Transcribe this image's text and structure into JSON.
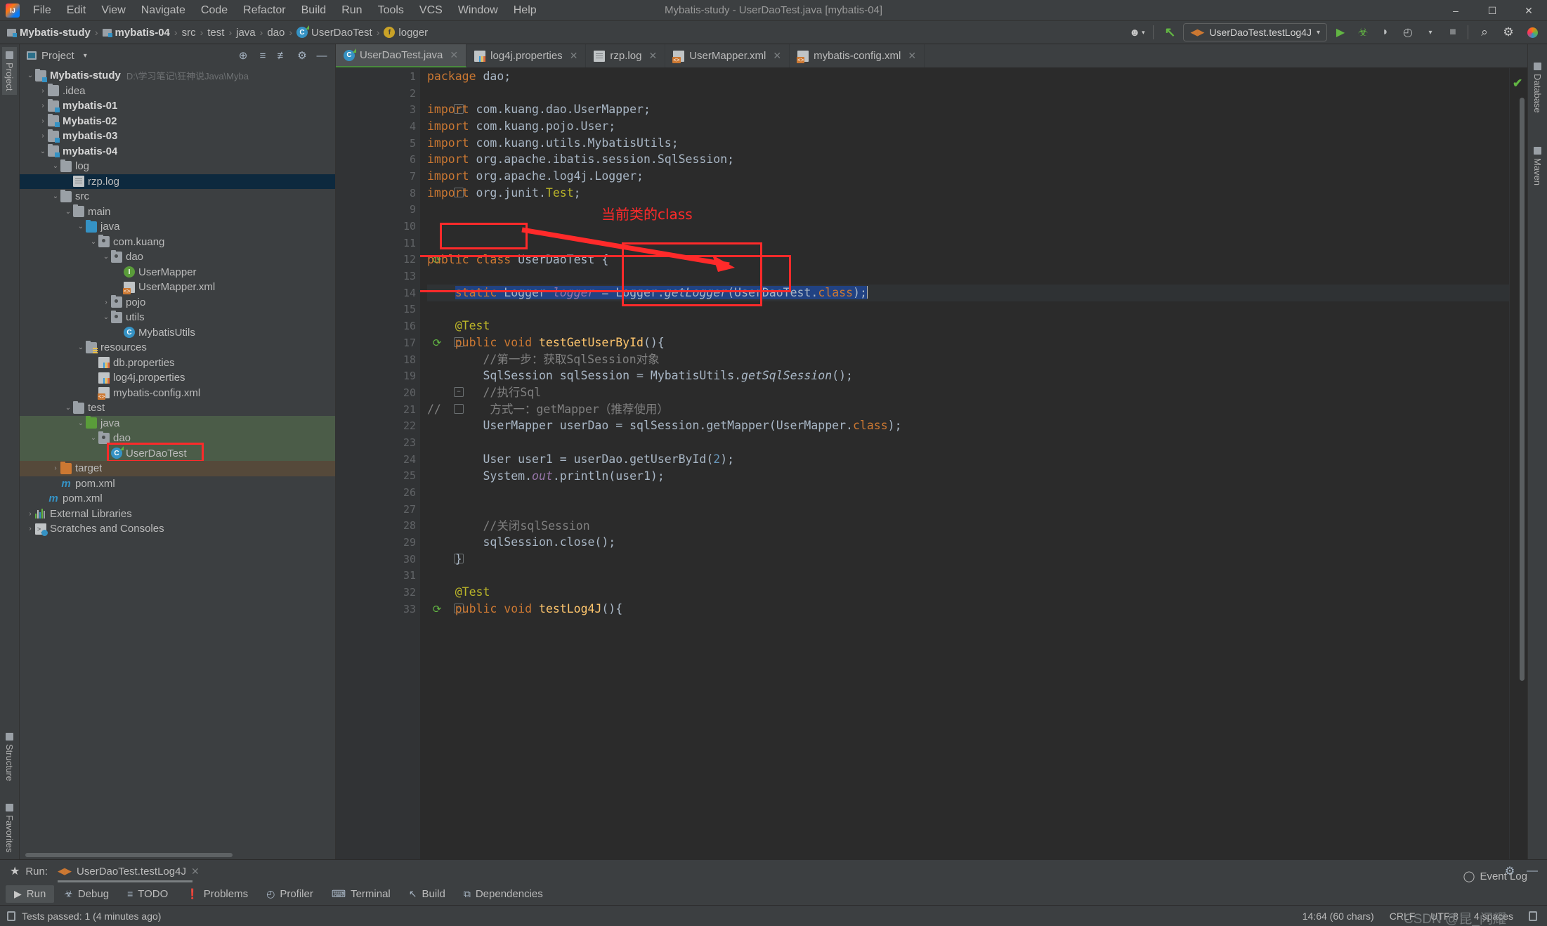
{
  "window": {
    "title": "Mybatis-study - UserDaoTest.java [mybatis-04]",
    "minimize": "–",
    "maximize": "☐",
    "close": "✕"
  },
  "menu": [
    {
      "label": "File"
    },
    {
      "label": "Edit"
    },
    {
      "label": "View"
    },
    {
      "label": "Navigate"
    },
    {
      "label": "Code"
    },
    {
      "label": "Refactor"
    },
    {
      "label": "Build"
    },
    {
      "label": "Run"
    },
    {
      "label": "Tools"
    },
    {
      "label": "VCS"
    },
    {
      "label": "Window"
    },
    {
      "label": "Help"
    }
  ],
  "breadcrumb": {
    "sep": "›",
    "items": [
      {
        "label": "Mybatis-study",
        "icon": "module-icon",
        "bold": true
      },
      {
        "label": "mybatis-04",
        "icon": "module-icon",
        "bold": true
      },
      {
        "label": "src",
        "icon": "none"
      },
      {
        "label": "test",
        "icon": "none"
      },
      {
        "label": "java",
        "icon": "none"
      },
      {
        "label": "dao",
        "icon": "none"
      },
      {
        "label": "UserDaoTest",
        "icon": "class-icon"
      },
      {
        "label": "logger",
        "icon": "field-icon"
      }
    ]
  },
  "toolbar": {
    "run_config": "UserDaoTest.testLog4J",
    "run_config_dropdown": "▾",
    "buttons": [
      {
        "name": "run-button",
        "glyph": "▶"
      },
      {
        "name": "debug-button",
        "glyph": "☣"
      },
      {
        "name": "run-with-coverage-button",
        "glyph": "◗"
      },
      {
        "name": "profiler-button",
        "glyph": "◴"
      },
      {
        "name": "profiler-dropdown",
        "glyph": "▾"
      },
      {
        "name": "stop-button",
        "glyph": "■"
      },
      {
        "name": "search-everywhere-button",
        "glyph": "⚲"
      },
      {
        "name": "settings-button",
        "glyph": "⚙"
      }
    ],
    "user_icon": "☻",
    "user_dropdown": "▾",
    "build_icon": "↖"
  },
  "left_rail": [
    {
      "label": "Project",
      "active": true
    },
    {
      "label": "Structure",
      "active": false
    },
    {
      "label": "Favorites",
      "active": false
    }
  ],
  "right_rail": [
    {
      "label": "Database"
    },
    {
      "label": "Maven"
    }
  ],
  "project_panel": {
    "title": "Project",
    "title_dropdown": "▾",
    "actions": [
      {
        "name": "select-opened-file-button",
        "glyph": "⊕"
      },
      {
        "name": "expand-all-button",
        "glyph": "≡"
      },
      {
        "name": "collapse-all-button",
        "glyph": "≢"
      },
      {
        "name": "settings-button",
        "glyph": "⚙"
      },
      {
        "name": "hide-button",
        "glyph": "—"
      }
    ],
    "tree": [
      {
        "label": "Mybatis-study",
        "path": "D:\\学习笔记\\狂神说Java\\Myba",
        "indent": 0,
        "arrow": "⌄",
        "icon": "folder-module",
        "bold": true,
        "bg": "none"
      },
      {
        "label": ".idea",
        "indent": 1,
        "arrow": "›",
        "icon": "folder",
        "bg": "none"
      },
      {
        "label": "mybatis-01",
        "indent": 1,
        "arrow": "›",
        "icon": "folder-module",
        "bold": true,
        "bg": "none"
      },
      {
        "label": "Mybatis-02",
        "indent": 1,
        "arrow": "›",
        "icon": "folder-module",
        "bold": true,
        "bg": "none"
      },
      {
        "label": "mybatis-03",
        "indent": 1,
        "arrow": "›",
        "icon": "folder-module",
        "bold": true,
        "bg": "none"
      },
      {
        "label": "mybatis-04",
        "indent": 1,
        "arrow": "⌄",
        "icon": "folder-module",
        "bold": true,
        "bg": "none"
      },
      {
        "label": "log",
        "indent": 2,
        "arrow": "⌄",
        "icon": "folder",
        "bg": "none"
      },
      {
        "label": "rzp.log",
        "indent": 3,
        "arrow": "",
        "icon": "file",
        "bg": "selected"
      },
      {
        "label": "src",
        "indent": 2,
        "arrow": "⌄",
        "icon": "folder",
        "bg": "none"
      },
      {
        "label": "main",
        "indent": 3,
        "arrow": "⌄",
        "icon": "folder",
        "bg": "none"
      },
      {
        "label": "java",
        "indent": 4,
        "arrow": "⌄",
        "icon": "folder-source",
        "bg": "none"
      },
      {
        "label": "com.kuang",
        "indent": 5,
        "arrow": "⌄",
        "icon": "package",
        "bg": "none"
      },
      {
        "label": "dao",
        "indent": 6,
        "arrow": "⌄",
        "icon": "package",
        "bg": "none"
      },
      {
        "label": "UserMapper",
        "indent": 7,
        "arrow": "",
        "icon": "interface",
        "bg": "none"
      },
      {
        "label": "UserMapper.xml",
        "indent": 7,
        "arrow": "",
        "icon": "xml",
        "bg": "none"
      },
      {
        "label": "pojo",
        "indent": 6,
        "arrow": "›",
        "icon": "package",
        "bg": "none"
      },
      {
        "label": "utils",
        "indent": 6,
        "arrow": "⌄",
        "icon": "package",
        "bg": "none"
      },
      {
        "label": "MybatisUtils",
        "indent": 7,
        "arrow": "",
        "icon": "class",
        "bg": "none"
      },
      {
        "label": "resources",
        "indent": 4,
        "arrow": "⌄",
        "icon": "folder-resource",
        "bg": "none"
      },
      {
        "label": "db.properties",
        "indent": 5,
        "arrow": "",
        "icon": "properties",
        "bg": "none"
      },
      {
        "label": "log4j.properties",
        "indent": 5,
        "arrow": "",
        "icon": "properties",
        "bg": "none"
      },
      {
        "label": "mybatis-config.xml",
        "indent": 5,
        "arrow": "",
        "icon": "xml",
        "bg": "none"
      },
      {
        "label": "test",
        "indent": 3,
        "arrow": "⌄",
        "icon": "folder",
        "bg": "none"
      },
      {
        "label": "java",
        "indent": 4,
        "arrow": "⌄",
        "icon": "folder-test",
        "bg": "green"
      },
      {
        "label": "dao",
        "indent": 5,
        "arrow": "⌄",
        "icon": "package",
        "bg": "green"
      },
      {
        "label": "UserDaoTest",
        "indent": 6,
        "arrow": "",
        "icon": "class-test",
        "bg": "green"
      },
      {
        "label": "target",
        "indent": 2,
        "arrow": "›",
        "icon": "folder-target",
        "bg": "brown"
      },
      {
        "label": "pom.xml",
        "indent": 2,
        "arrow": "",
        "icon": "maven",
        "bg": "none"
      },
      {
        "label": "pom.xml",
        "indent": 1,
        "arrow": "",
        "icon": "maven",
        "bg": "none"
      },
      {
        "label": "External Libraries",
        "indent": 0,
        "arrow": "›",
        "icon": "libraries",
        "bg": "none"
      },
      {
        "label": "Scratches and Consoles",
        "indent": 0,
        "arrow": "›",
        "icon": "scratch",
        "bg": "none"
      }
    ]
  },
  "editor_tabs": [
    {
      "label": "UserDaoTest.java",
      "icon": "class-test",
      "active": true,
      "close": "✕"
    },
    {
      "label": "log4j.properties",
      "icon": "properties",
      "active": false,
      "close": "✕"
    },
    {
      "label": "rzp.log",
      "icon": "file",
      "active": false,
      "close": "✕"
    },
    {
      "label": "UserMapper.xml",
      "icon": "xml",
      "active": false,
      "close": "✕"
    },
    {
      "label": "mybatis-config.xml",
      "icon": "xml",
      "active": false,
      "close": "✕"
    }
  ],
  "code": {
    "lines": [
      {
        "n": 1,
        "tokens": [
          {
            "t": "package ",
            "c": "kw"
          },
          {
            "t": "dao",
            "c": ""
          },
          {
            "t": ";",
            "c": ""
          }
        ],
        "indent": 0
      },
      {
        "n": 2,
        "tokens": [],
        "indent": 0
      },
      {
        "n": 3,
        "tokens": [
          {
            "t": "import ",
            "c": "kw"
          },
          {
            "t": "com.kuang.dao.UserMapper",
            "c": ""
          },
          {
            "t": ";",
            "c": ""
          }
        ],
        "indent": 0,
        "fold": "minus"
      },
      {
        "n": 4,
        "tokens": [
          {
            "t": "import ",
            "c": "kw"
          },
          {
            "t": "com.kuang.pojo.User",
            "c": ""
          },
          {
            "t": ";",
            "c": ""
          }
        ],
        "indent": 0
      },
      {
        "n": 5,
        "tokens": [
          {
            "t": "import ",
            "c": "kw"
          },
          {
            "t": "com.kuang.utils.MybatisUtils",
            "c": ""
          },
          {
            "t": ";",
            "c": ""
          }
        ],
        "indent": 0
      },
      {
        "n": 6,
        "tokens": [
          {
            "t": "import ",
            "c": "kw"
          },
          {
            "t": "org.apache.ibatis.session.SqlSession",
            "c": ""
          },
          {
            "t": ";",
            "c": ""
          }
        ],
        "indent": 0
      },
      {
        "n": 7,
        "tokens": [
          {
            "t": "import ",
            "c": "kw"
          },
          {
            "t": "org.apache.log4j.Logger",
            "c": ""
          },
          {
            "t": ";",
            "c": ""
          }
        ],
        "indent": 0
      },
      {
        "n": 8,
        "tokens": [
          {
            "t": "import ",
            "c": "kw"
          },
          {
            "t": "org.junit.",
            "c": ""
          },
          {
            "t": "Test",
            "c": "ann"
          },
          {
            "t": ";",
            "c": ""
          }
        ],
        "indent": 0,
        "fold": "end"
      },
      {
        "n": 9,
        "tokens": [],
        "indent": 0
      },
      {
        "n": 10,
        "tokens": [],
        "indent": 0
      },
      {
        "n": 11,
        "tokens": [],
        "indent": 0
      },
      {
        "n": 12,
        "tokens": [
          {
            "t": "public class ",
            "c": "kw"
          },
          {
            "t": "UserDaoTest ",
            "c": ""
          },
          {
            "t": "{",
            "c": ""
          }
        ],
        "indent": 0,
        "gutter": "run-test"
      },
      {
        "n": 13,
        "tokens": [],
        "indent": 0
      },
      {
        "n": 14,
        "tokens": [
          {
            "t": "    ",
            "c": ""
          },
          {
            "t": "static ",
            "c": "kw sel"
          },
          {
            "t": "Logger ",
            "c": "sel"
          },
          {
            "t": "logger",
            "c": "fld sel"
          },
          {
            "t": " = Logger.",
            "c": "sel"
          },
          {
            "t": "getLogger",
            "c": "sta sel"
          },
          {
            "t": "(UserDaoTest.",
            "c": "sel"
          },
          {
            "t": "class",
            "c": "kw sel"
          },
          {
            "t": ");",
            "c": "sel"
          }
        ],
        "indent": 0,
        "gutter": "bulb",
        "highlight": true
      },
      {
        "n": 15,
        "tokens": [],
        "indent": 0
      },
      {
        "n": 16,
        "tokens": [
          {
            "t": "    ",
            "c": ""
          },
          {
            "t": "@Test",
            "c": "ann"
          }
        ],
        "indent": 0
      },
      {
        "n": 17,
        "tokens": [
          {
            "t": "    ",
            "c": ""
          },
          {
            "t": "public void ",
            "c": "kw"
          },
          {
            "t": "testGetUserById",
            "c": "mtd"
          },
          {
            "t": "(){",
            "c": ""
          }
        ],
        "indent": 0,
        "gutter": "run-test",
        "fold": "minus"
      },
      {
        "n": 18,
        "tokens": [
          {
            "t": "        //第一步：获取SqlSession对象",
            "c": "cmt"
          }
        ],
        "indent": 0
      },
      {
        "n": 19,
        "tokens": [
          {
            "t": "        SqlSession sqlSession = MybatisUtils.",
            "c": ""
          },
          {
            "t": "getSqlSession",
            "c": "sta"
          },
          {
            "t": "();",
            "c": ""
          }
        ],
        "indent": 0
      },
      {
        "n": 20,
        "tokens": [
          {
            "t": "        //执行Sql",
            "c": "cmt"
          }
        ],
        "indent": 0,
        "fold": "minus"
      },
      {
        "n": 21,
        "tokens": [
          {
            "t": "//",
            "c": "cmt"
          },
          {
            "t": "       方式一：getMapper（推荐使用）",
            "c": "cmt"
          }
        ],
        "indent": 0,
        "fold": "end"
      },
      {
        "n": 22,
        "tokens": [
          {
            "t": "        UserMapper userDao = sqlSession.getMapper(UserMapper.",
            "c": ""
          },
          {
            "t": "class",
            "c": "kw"
          },
          {
            "t": ");",
            "c": ""
          }
        ],
        "indent": 0
      },
      {
        "n": 23,
        "tokens": [],
        "indent": 0
      },
      {
        "n": 24,
        "tokens": [
          {
            "t": "        User user1 = userDao.getUserById(",
            "c": ""
          },
          {
            "t": "2",
            "c": "num"
          },
          {
            "t": ");",
            "c": ""
          }
        ],
        "indent": 0
      },
      {
        "n": 25,
        "tokens": [
          {
            "t": "        System.",
            "c": ""
          },
          {
            "t": "out",
            "c": "fld"
          },
          {
            "t": ".println(user1);",
            "c": ""
          }
        ],
        "indent": 0
      },
      {
        "n": 26,
        "tokens": [],
        "indent": 0
      },
      {
        "n": 27,
        "tokens": [],
        "indent": 0
      },
      {
        "n": 28,
        "tokens": [
          {
            "t": "        //关闭sqlSession",
            "c": "cmt"
          }
        ],
        "indent": 0
      },
      {
        "n": 29,
        "tokens": [
          {
            "t": "        sqlSession.close();",
            "c": ""
          }
        ],
        "indent": 0
      },
      {
        "n": 30,
        "tokens": [
          {
            "t": "    }",
            "c": ""
          }
        ],
        "indent": 0,
        "fold": "end"
      },
      {
        "n": 31,
        "tokens": [],
        "indent": 0
      },
      {
        "n": 32,
        "tokens": [
          {
            "t": "    ",
            "c": ""
          },
          {
            "t": "@Test",
            "c": "ann"
          }
        ],
        "indent": 0
      },
      {
        "n": 33,
        "tokens": [
          {
            "t": "    ",
            "c": ""
          },
          {
            "t": "public void ",
            "c": "kw"
          },
          {
            "t": "testLog4J",
            "c": "mtd"
          },
          {
            "t": "(){",
            "c": ""
          }
        ],
        "indent": 0,
        "gutter": "run-test",
        "fold": "minus"
      }
    ]
  },
  "annotations": {
    "note_text": "当前类的class",
    "color": "#ff2a2a"
  },
  "run_panel": {
    "star": "★",
    "label": "Run:",
    "tab": "UserDaoTest.testLog4J",
    "tab_close": "✕",
    "settings_glyph": "⚙",
    "hide_glyph": "—",
    "status": "Tests passed: 1 (4 minutes ago)"
  },
  "tool_strip": [
    {
      "label": "Run",
      "glyph": "▶",
      "active": true
    },
    {
      "label": "Debug",
      "glyph": "☣",
      "active": false
    },
    {
      "label": "TODO",
      "glyph": "≡",
      "active": false
    },
    {
      "label": "Problems",
      "glyph": "❗",
      "active": false
    },
    {
      "label": "Profiler",
      "glyph": "◴",
      "active": false
    },
    {
      "label": "Terminal",
      "glyph": "⌨",
      "active": false
    },
    {
      "label": "Build",
      "glyph": "↖",
      "active": false
    },
    {
      "label": "Dependencies",
      "glyph": "⧉",
      "active": false
    }
  ],
  "status_bar": {
    "event_log": "Event Log",
    "event_log_glyph": "◯",
    "caret_position": "14:64 (60 chars)",
    "line_separator": "CRLF",
    "encoding": "UTF-8",
    "indent": "4 spaces",
    "watermark": "CSDN @昆_闪耀"
  }
}
